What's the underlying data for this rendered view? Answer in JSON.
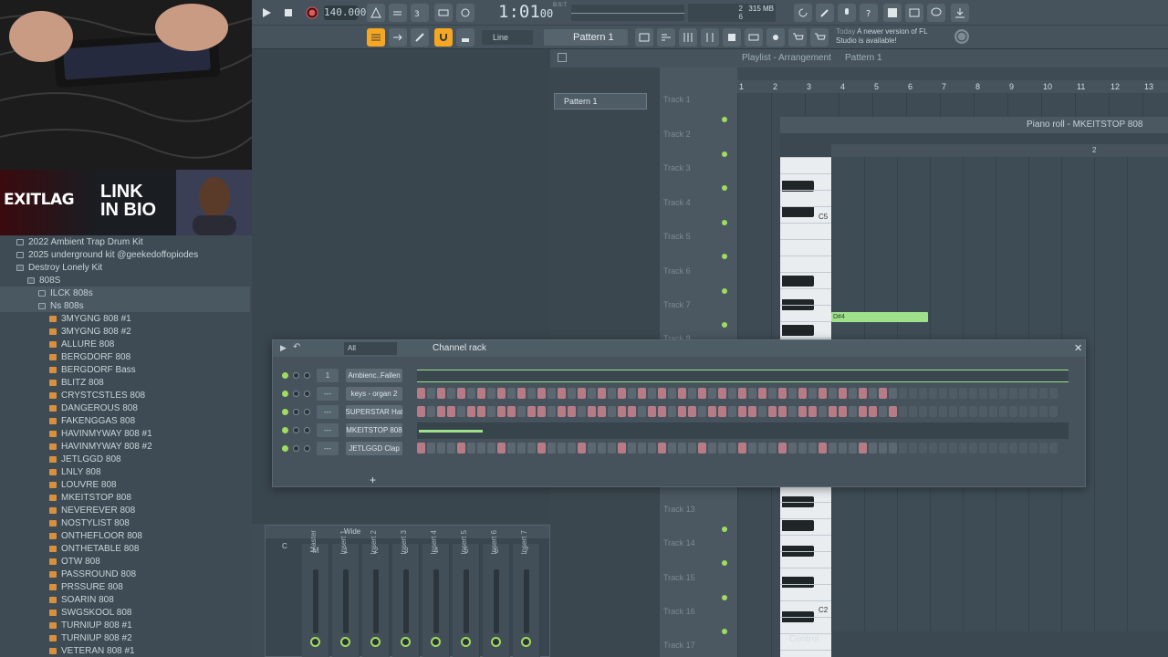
{
  "toolbar": {
    "tempo": "140.000",
    "time": "1:01",
    "time_sub": "00",
    "time_label": "B:S:T",
    "cpu_top": "2",
    "cpu_bottom": "6",
    "memory": "315 MB",
    "pattern": "Pattern 1",
    "snap": "Line",
    "news_title": "Today",
    "news_text": "A newer version of FL Studio is available!"
  },
  "banner": {
    "brand": "EXITLAG",
    "cta_line1": "LINK",
    "cta_line2": "IN BIO"
  },
  "browser": {
    "items": [
      {
        "label": "2022 Ambient Trap Drum Kit",
        "indent": 1,
        "type": "folder"
      },
      {
        "label": "2025 underground kit @geekedoffopiodes",
        "indent": 1,
        "type": "folder"
      },
      {
        "label": "Destroy Lonely Kit",
        "indent": 1,
        "type": "open"
      },
      {
        "label": "808S",
        "indent": 2,
        "type": "open"
      },
      {
        "label": "ILCK 808s",
        "indent": 3,
        "type": "folder",
        "hl": true
      },
      {
        "label": "Ns 808s",
        "indent": 3,
        "type": "open",
        "hl": true
      },
      {
        "label": "3MYGNG 808 #1",
        "indent": 4,
        "type": "file"
      },
      {
        "label": "3MYGNG 808 #2",
        "indent": 4,
        "type": "file"
      },
      {
        "label": "ALLURE 808",
        "indent": 4,
        "type": "file"
      },
      {
        "label": "BERGDORF 808",
        "indent": 4,
        "type": "file"
      },
      {
        "label": "BERGDORF Bass",
        "indent": 4,
        "type": "file"
      },
      {
        "label": "BLITZ 808",
        "indent": 4,
        "type": "file"
      },
      {
        "label": "CRYSTCSTLES 808",
        "indent": 4,
        "type": "file"
      },
      {
        "label": "DANGEROUS 808",
        "indent": 4,
        "type": "file"
      },
      {
        "label": "FAKENGGAS 808",
        "indent": 4,
        "type": "file"
      },
      {
        "label": "HAVINMYWAY 808 #1",
        "indent": 4,
        "type": "file"
      },
      {
        "label": "HAVINMYWAY 808 #2",
        "indent": 4,
        "type": "file"
      },
      {
        "label": "JETLGGD 808",
        "indent": 4,
        "type": "file"
      },
      {
        "label": "LNLY 808",
        "indent": 4,
        "type": "file"
      },
      {
        "label": "LOUVRE 808",
        "indent": 4,
        "type": "file"
      },
      {
        "label": "MKEITSTOP 808",
        "indent": 4,
        "type": "file"
      },
      {
        "label": "NEVEREVER 808",
        "indent": 4,
        "type": "file"
      },
      {
        "label": "NOSTYLIST 808",
        "indent": 4,
        "type": "file"
      },
      {
        "label": "ONTHEFLOOR 808",
        "indent": 4,
        "type": "file"
      },
      {
        "label": "ONTHETABLE 808",
        "indent": 4,
        "type": "file"
      },
      {
        "label": "OTW 808",
        "indent": 4,
        "type": "file"
      },
      {
        "label": "PASSROUND 808",
        "indent": 4,
        "type": "file"
      },
      {
        "label": "PRSSURE 808",
        "indent": 4,
        "type": "file"
      },
      {
        "label": "SOARIN 808",
        "indent": 4,
        "type": "file"
      },
      {
        "label": "SWGSKOOL 808",
        "indent": 4,
        "type": "file"
      },
      {
        "label": "TURNIUP 808 #1",
        "indent": 4,
        "type": "file"
      },
      {
        "label": "TURNIUP 808 #2",
        "indent": 4,
        "type": "file"
      },
      {
        "label": "VETERAN 808 #1",
        "indent": 4,
        "type": "file"
      }
    ]
  },
  "pattern_list": {
    "items": [
      "Pattern 1"
    ]
  },
  "playlist": {
    "title": "Playlist - Arrangement",
    "pattern": "Pattern 1",
    "ruler": [
      "1",
      "2",
      "3",
      "4",
      "5",
      "6",
      "7",
      "8",
      "9",
      "10",
      "11",
      "12",
      "13"
    ],
    "tracks": [
      "Track 1",
      "Track 2",
      "Track 3",
      "Track 4",
      "Track 5",
      "Track 6",
      "Track 7",
      "Track 8",
      "Track 13",
      "Track 14",
      "Track 15",
      "Track 16",
      "Track 17"
    ]
  },
  "piano_roll": {
    "title": "Piano roll - MKEITSTOP 808",
    "key_c5": "C5",
    "key_c2": "C2",
    "note_label": "D#4",
    "ruler_2": "2",
    "control_label": "Control"
  },
  "channel_rack": {
    "title": "Channel rack",
    "filter": "All",
    "channels": [
      {
        "name": "Ambienc..Fallen",
        "num": "1",
        "kind": "wave"
      },
      {
        "name": "keys - organ 2",
        "num": "---",
        "kind": "steps"
      },
      {
        "name": "SUPERSTAR Hat",
        "num": "---",
        "kind": "steps"
      },
      {
        "name": "MKEITSTOP 808",
        "num": "---",
        "kind": "roll"
      },
      {
        "name": "JETLGGD Clap",
        "num": "---",
        "kind": "steps"
      }
    ]
  },
  "mixer": {
    "preset": "Wide",
    "strips": [
      {
        "num": "M",
        "label": "Master"
      },
      {
        "num": "1",
        "label": "Insert 1"
      },
      {
        "num": "2",
        "label": "Insert 2"
      },
      {
        "num": "3",
        "label": "Insert 3"
      },
      {
        "num": "4",
        "label": "Insert 4"
      },
      {
        "num": "5",
        "label": "Insert 5"
      },
      {
        "num": "6",
        "label": "Insert 6"
      },
      {
        "num": "7",
        "label": "Insert 7"
      }
    ],
    "first_col": "C",
    "scale": [
      "3",
      "6",
      "9",
      "12",
      "15"
    ]
  },
  "colors": {
    "accent": "#9fdc5f",
    "note": "#9fe08a",
    "step_red": "#b77b86",
    "step_dark": "#56636d",
    "highlight": "#f5a623"
  }
}
